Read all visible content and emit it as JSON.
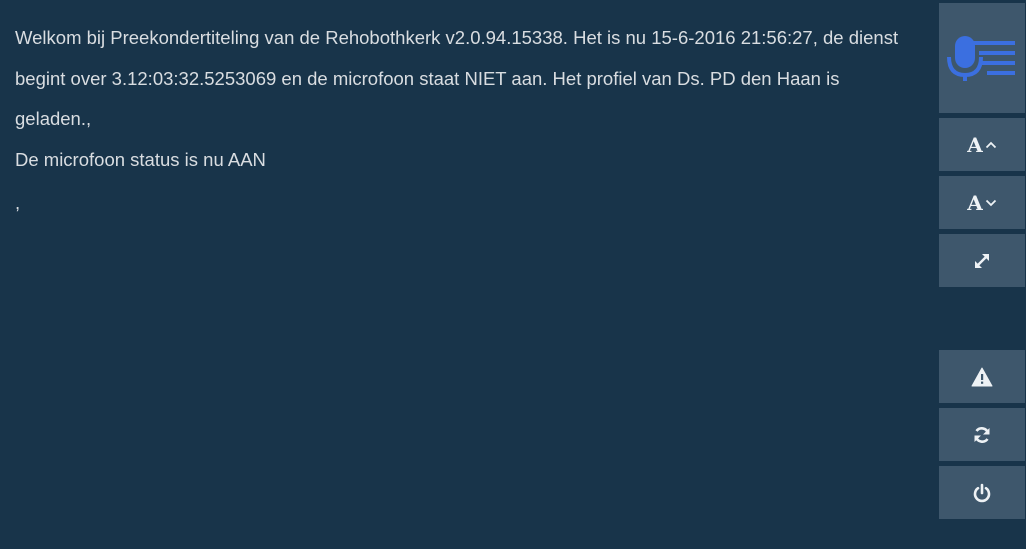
{
  "transcript": {
    "lines": [
      "Welkom bij Preekondertiteling van de Rehobothkerk v2.0.94.15338. Het is nu 15-6-2016 21:56:27, de dienst begint over 3.12:03:32.5253069 en de microfoon staat NIET aan. Het profiel van Ds. PD den Haan is geladen.,",
      "De microfoon status is nu AAN",
      ","
    ]
  },
  "toolbar": {
    "logo_icon": "microphone-subtitles-icon",
    "increase_font_letter": "A",
    "decrease_font_letter": "A",
    "fullscreen_icon": "expand-icon",
    "warning_icon": "warning-icon",
    "refresh_icon": "refresh-icon",
    "power_icon": "power-icon"
  },
  "colors": {
    "background": "#18344a",
    "button": "#3e576c",
    "text": "#d9dde1",
    "logo_blue": "#3b6fe0"
  }
}
